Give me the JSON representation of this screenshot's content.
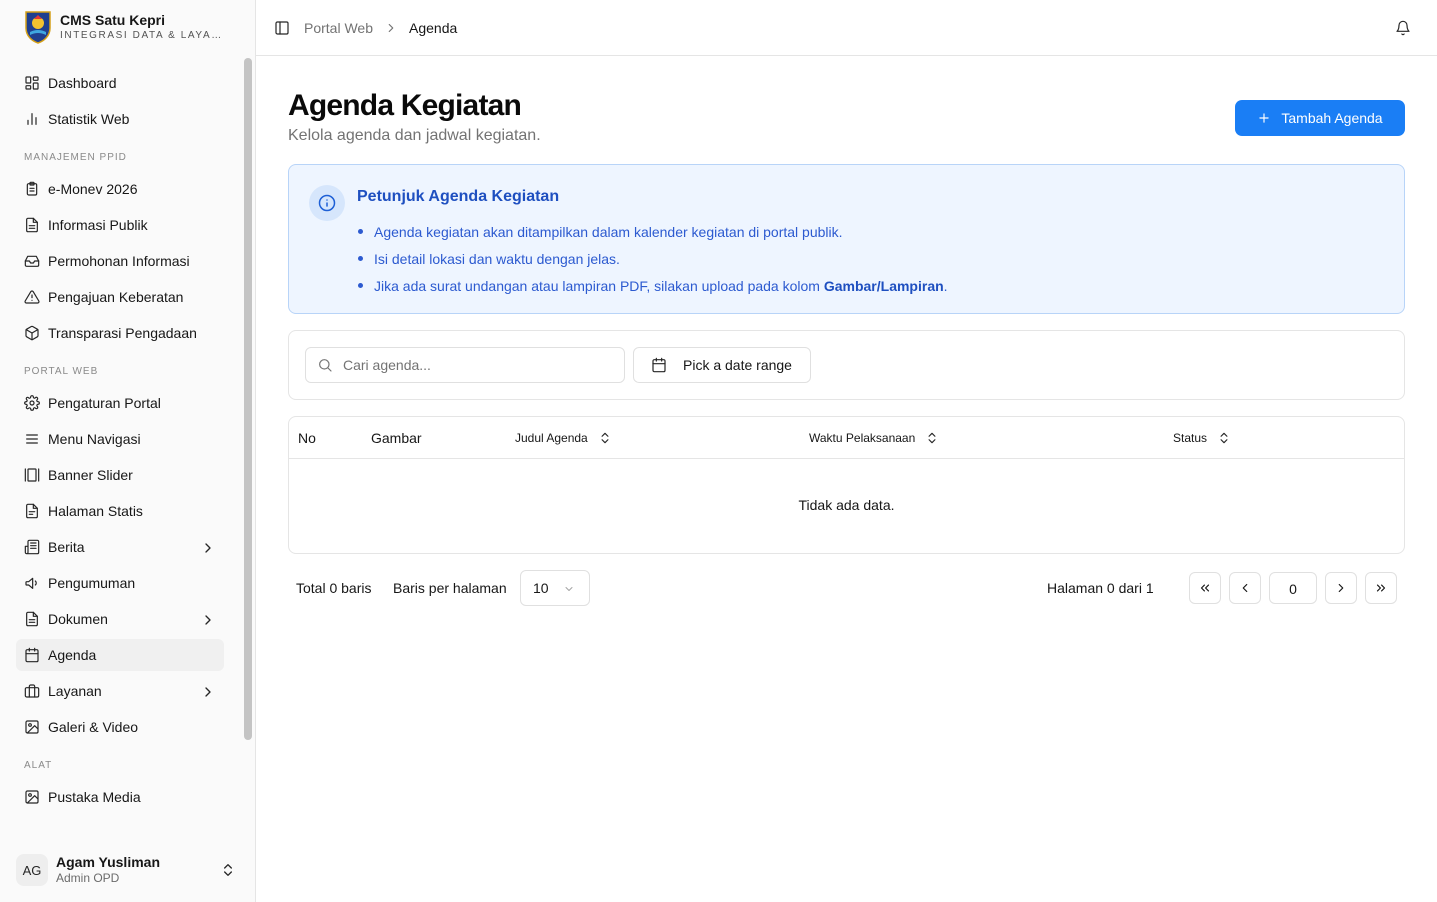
{
  "brand": {
    "title": "CMS Satu Kepri",
    "subtitle": "INTEGRASI DATA & LAYANAN"
  },
  "sidebar": {
    "items_top": [
      {
        "label": "Dashboard",
        "icon": "layout-dashboard-icon"
      },
      {
        "label": "Statistik Web",
        "icon": "bar-chart-icon"
      }
    ],
    "group_ppid": "MANAJEMEN PPID",
    "items_ppid": [
      {
        "label": "e-Monev 2026",
        "icon": "clipboard-list-icon"
      },
      {
        "label": "Informasi Publik",
        "icon": "file-text-icon"
      },
      {
        "label": "Permohonan Informasi",
        "icon": "inbox-icon"
      },
      {
        "label": "Pengajuan Keberatan",
        "icon": "alert-triangle-icon"
      },
      {
        "label": "Transparasi Pengadaan",
        "icon": "package-icon"
      }
    ],
    "group_portal": "PORTAL WEB",
    "items_portal": [
      {
        "label": "Pengaturan Portal",
        "icon": "settings-icon"
      },
      {
        "label": "Menu Navigasi",
        "icon": "menu-icon"
      },
      {
        "label": "Banner Slider",
        "icon": "gallery-horizontal-icon"
      },
      {
        "label": "Halaman Statis",
        "icon": "file-icon"
      },
      {
        "label": "Berita",
        "icon": "newspaper-icon"
      },
      {
        "label": "Pengumuman",
        "icon": "megaphone-icon"
      },
      {
        "label": "Dokumen",
        "icon": "file-text-icon"
      },
      {
        "label": "Agenda",
        "icon": "calendar-icon"
      },
      {
        "label": "Layanan",
        "icon": "briefcase-icon"
      },
      {
        "label": "Galeri & Video",
        "icon": "image-icon"
      }
    ],
    "group_tools": "ALAT",
    "items_tools": [
      {
        "label": "Pustaka Media",
        "icon": "images-icon"
      }
    ],
    "active": "Agenda"
  },
  "user": {
    "initials": "AG",
    "name": "Agam Yusliman",
    "role": "Admin OPD"
  },
  "header": {
    "breadcrumb_parent": "Portal Web",
    "breadcrumb_current": "Agenda"
  },
  "main": {
    "title": "Agenda Kegiatan",
    "description": "Kelola agenda dan jadwal kegiatan.",
    "add_button": "Tambah Agenda"
  },
  "info": {
    "title": "Petunjuk Agenda Kegiatan",
    "item1": "Agenda kegiatan akan ditampilkan dalam kalender kegiatan di portal publik.",
    "item2": "Isi detail lokasi dan waktu dengan jelas.",
    "item3_prefix": "Jika ada surat undangan atau lampiran PDF, silakan upload pada kolom ",
    "item3_bold": "Gambar/Lampiran",
    "item3_suffix": "."
  },
  "filter": {
    "search_placeholder": "Cari agenda...",
    "search_value": "",
    "date_button": "Pick a date range"
  },
  "table": {
    "columns": [
      "No",
      "Gambar",
      "Judul Agenda",
      "Waktu Pelaksanaan",
      "Status"
    ],
    "empty_text": "Tidak ada data."
  },
  "pagination": {
    "total": "Total 0 baris",
    "rows_label": "Baris per halaman",
    "rows_value": "10",
    "page_info": "Halaman 0 dari 1",
    "page_input": "0"
  },
  "colors": {
    "primary": "#1a7ef5",
    "info_bg": "#eef5ff",
    "info_text": "#2c5ad0",
    "active_bg": "#f0f0f0"
  }
}
